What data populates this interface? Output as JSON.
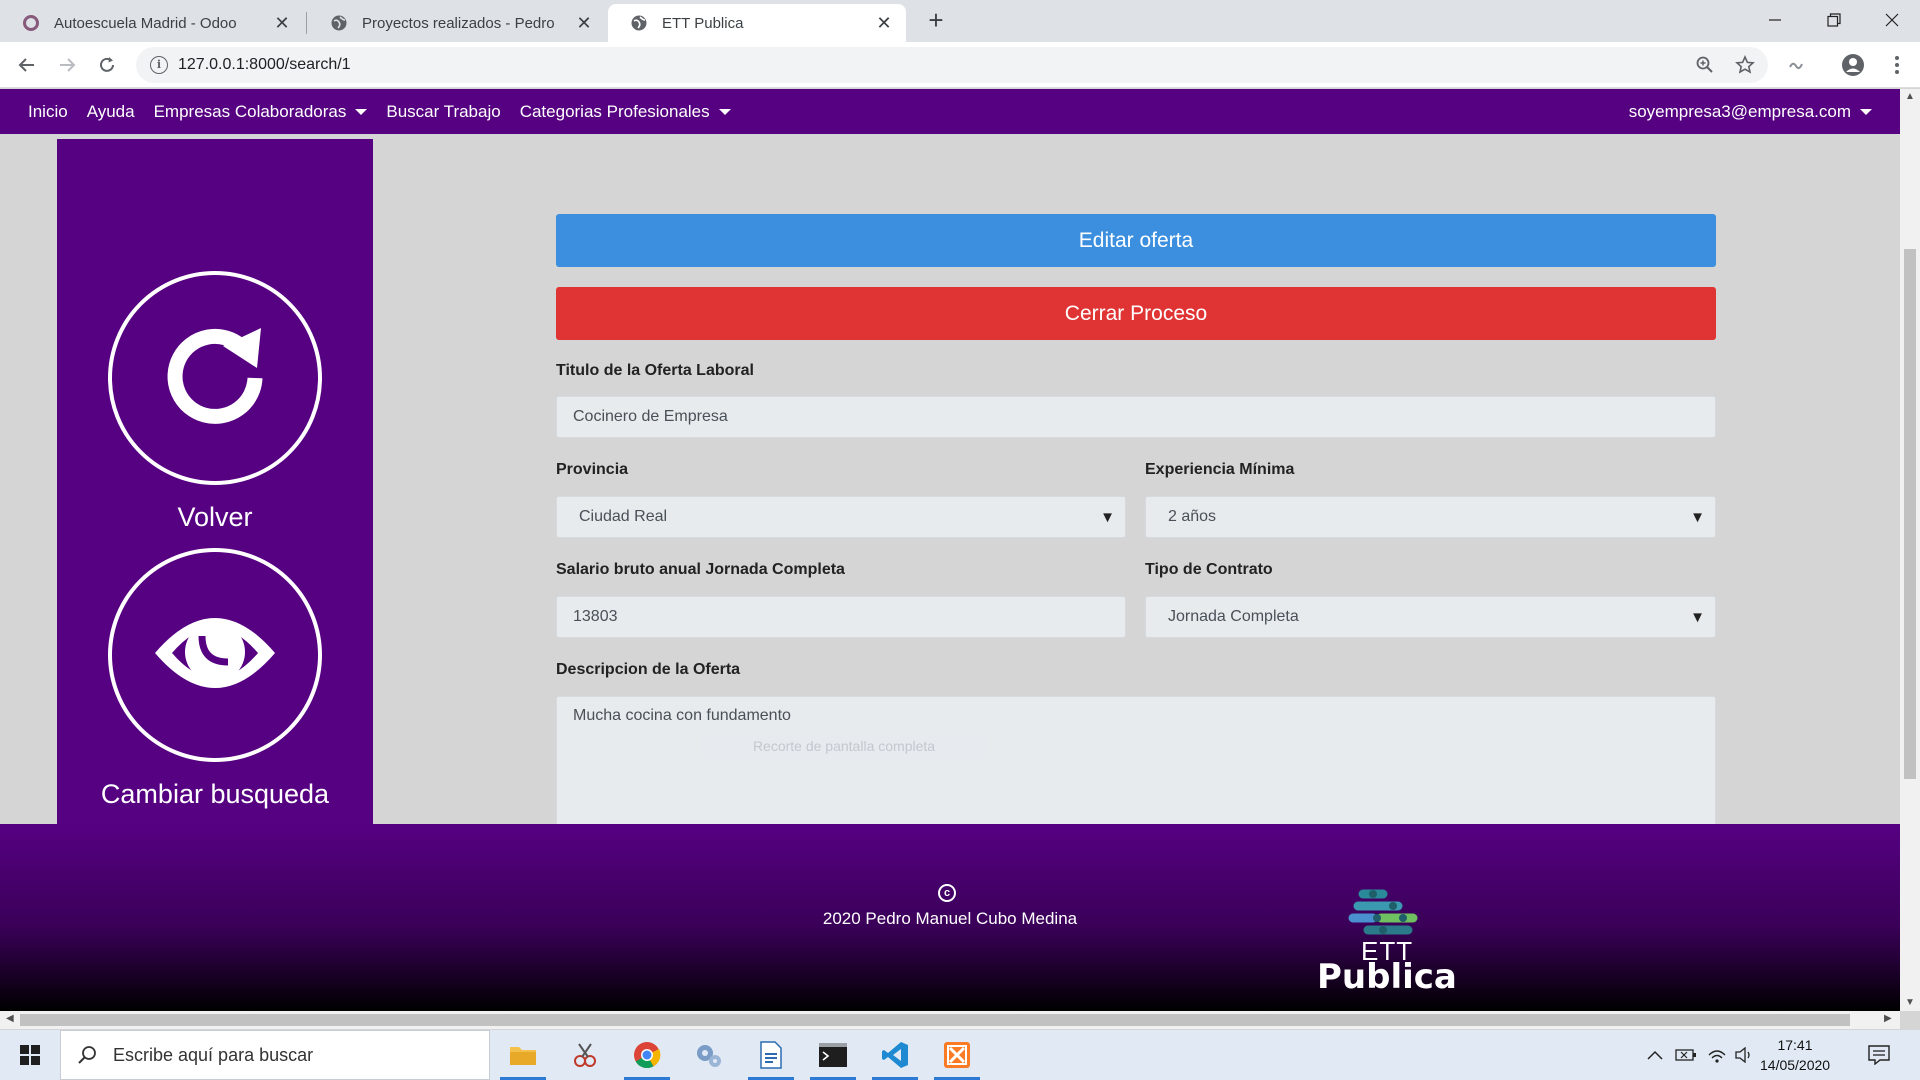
{
  "browser": {
    "tabs": [
      {
        "title": "Autoescuela Madrid - Odoo",
        "icon": "odoo-icon",
        "active": false
      },
      {
        "title": "Proyectos realizados - Pedro",
        "icon": "globe-icon",
        "active": false
      },
      {
        "title": "ETT Publica",
        "icon": "globe-icon",
        "active": true
      }
    ],
    "new_tab": "+",
    "url": "127.0.0.1:8000/search/1"
  },
  "nav": {
    "items": [
      {
        "label": "Inicio",
        "dropdown": false
      },
      {
        "label": "Ayuda",
        "dropdown": false
      },
      {
        "label": "Empresas Colaboradoras",
        "dropdown": true
      },
      {
        "label": "Buscar Trabajo",
        "dropdown": false
      },
      {
        "label": "Categorias Profesionales",
        "dropdown": true
      }
    ],
    "user": "soyempresa3@empresa.com"
  },
  "sidebar": {
    "back_label": "Volver",
    "change_label": "Cambiar busqueda"
  },
  "form": {
    "edit_button": "Editar oferta",
    "close_button": "Cerrar Proceso",
    "title_label": "Titulo de la Oferta Laboral",
    "title_value": "Cocinero de Empresa",
    "province_label": "Provincia",
    "province_value": "Ciudad Real",
    "experience_label": "Experiencia Mínima",
    "experience_value": "2 años",
    "salary_label": "Salario bruto anual Jornada Completa",
    "salary_value": "13803",
    "contract_label": "Tipo de Contrato",
    "contract_value": "Jornada Completa",
    "description_label": "Descripcion de la Oferta",
    "description_value": "Mucha cocina con fundamento"
  },
  "overlay": {
    "snip_hint": "Recorte de pantalla completa"
  },
  "footer": {
    "copyright_symbol": "c",
    "copyright_text": "2020 Pedro Manuel Cubo Medina",
    "logo_line1": "ETT",
    "logo_line2": "Publica"
  },
  "taskbar": {
    "search_placeholder": "Escribe aquí para buscar",
    "time": "17:41",
    "date": "14/05/2020"
  },
  "colors": {
    "brand_purple": "#560082",
    "edit_blue": "#3b8fde",
    "close_red": "#e03434",
    "page_bg": "#d4d5d4"
  }
}
